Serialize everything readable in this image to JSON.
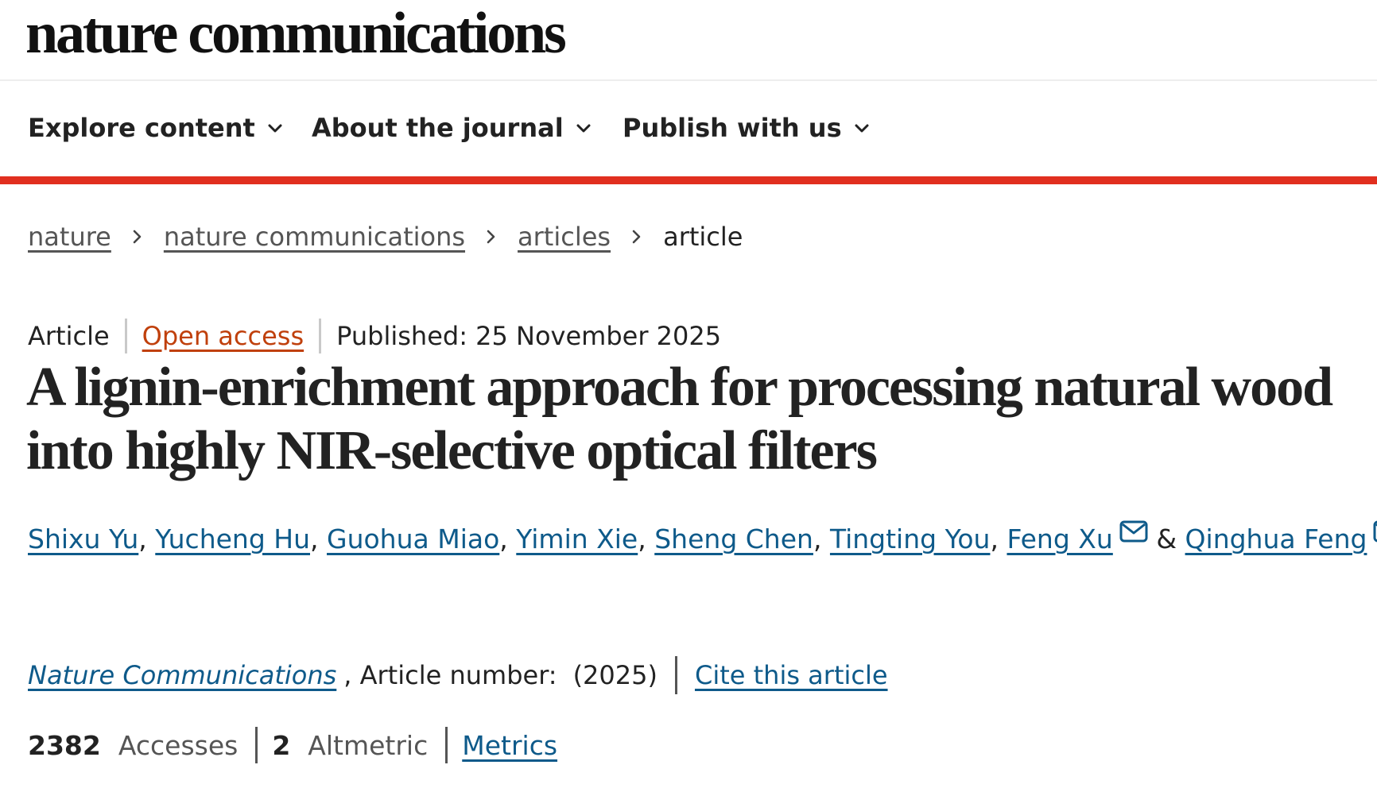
{
  "header": {
    "logo": "nature communications"
  },
  "nav": {
    "items": [
      {
        "label": "Explore content"
      },
      {
        "label": "About the journal"
      },
      {
        "label": "Publish with us"
      }
    ]
  },
  "colors": {
    "accent_rule": "#e12f1f",
    "link": "#0e5a8a",
    "open_access": "#c0400c"
  },
  "breadcrumb": {
    "items": [
      "nature",
      "nature communications",
      "articles"
    ],
    "current": "article"
  },
  "article": {
    "type": "Article",
    "access": "Open access",
    "published": "Published: 25 November 2025",
    "title": "A lignin-enrichment approach for processing natural wood into highly NIR-selective optical filters",
    "authors": [
      "Shixu Yu",
      "Yucheng Hu",
      "Guohua Miao",
      "Yimin Xie",
      "Sheng Chen",
      "Tingting You",
      "Feng Xu",
      "Qinghua Feng"
    ],
    "author_sep": ",",
    "author_amp": "&",
    "journal": "Nature Communications",
    "article_number": ", Article number:",
    "year": "(2025)",
    "cite": "Cite this article"
  },
  "metrics": {
    "accesses_count": "2382",
    "accesses_label": "Accesses",
    "altmetric_count": "2",
    "altmetric_label": "Altmetric",
    "link": "Metrics"
  },
  "icons": {
    "nav_dropdown": "chevron-down-icon",
    "breadcrumb_separator": "chevron-right-icon",
    "author_contact": "envelope-icon"
  }
}
